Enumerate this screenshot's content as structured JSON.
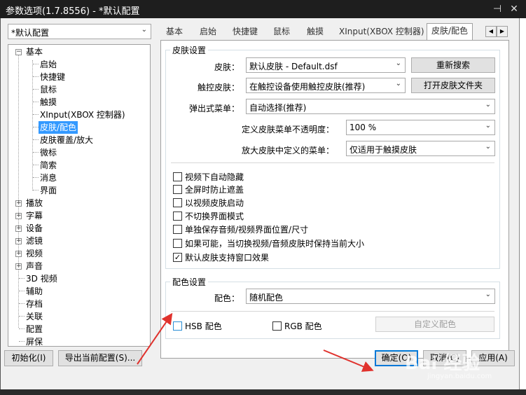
{
  "window": {
    "title": "参数选项(1.7.8556) - *默认配置",
    "pin_icon": "pin-icon",
    "close_icon": "close-icon"
  },
  "profile_combo": {
    "value": "*默认配置"
  },
  "tree": {
    "root": "基本",
    "children": [
      "启始",
      "快捷键",
      "鼠标",
      "触摸",
      "XInput(XBOX 控制器)",
      "皮肤/配色",
      "皮肤覆盖/放大",
      "微标",
      "简索",
      "消息",
      "界面"
    ],
    "selected": "皮肤/配色",
    "collapsed": [
      "播放",
      "字幕",
      "设备",
      "滤镜",
      "视频",
      "声音"
    ],
    "leaves": [
      "3D 视频",
      "辅助",
      "存档",
      "关联",
      "配置",
      "屏保"
    ]
  },
  "tabs": [
    "基本",
    "启始",
    "快捷键",
    "鼠标",
    "触摸",
    "XInput(XBOX 控制器)",
    "皮肤/配色"
  ],
  "active_tab": "皮肤/配色",
  "skin_settings": {
    "group_title": "皮肤设置",
    "skin_label": "皮肤：",
    "skin_value": "默认皮肤 - Default.dsf",
    "research_button": "重新搜索",
    "touch_skin_label": "触控皮肤：",
    "touch_skin_value": "在触控设备使用触控皮肤(推荐)",
    "open_folder_button": "打开皮肤文件夹",
    "popup_menu_label": "弹出式菜单：",
    "popup_menu_value": "自动选择(推荐)",
    "opacity_label": "定义皮肤菜单不透明度：",
    "opacity_value": "100 %",
    "zoom_menu_label": "放大皮肤中定义的菜单：",
    "zoom_menu_value": "仅适用于触摸皮肤",
    "checkboxes": [
      {
        "label": "视频下自动隐藏",
        "checked": false
      },
      {
        "label": "全屏时防止遮盖",
        "checked": false
      },
      {
        "label": "以视频皮肤启动",
        "checked": false
      },
      {
        "label": "不切换界面模式",
        "checked": false
      },
      {
        "label": "单独保存音频/视频界面位置/尺寸",
        "checked": false
      },
      {
        "label": "如果可能，当切换视频/音频皮肤时保持当前大小",
        "checked": false
      },
      {
        "label": "默认皮肤支持窗口效果",
        "checked": true
      }
    ],
    "check_mark": "✓"
  },
  "color_settings": {
    "group_title": "配色设置",
    "color_label": "配色：",
    "color_value": "随机配色",
    "hsb_label": "HSB 配色",
    "rgb_label": "RGB 配色",
    "custom_button": "自定义配色"
  },
  "bottom_buttons": {
    "init": "初始化(I)",
    "export": "导出当前配置(S)...",
    "ok": "确定(O)",
    "cancel": "取消(C)",
    "apply": "应用(A)"
  },
  "watermark": "Bai 经验",
  "watermark_sub": "jingyan.baidu.com",
  "colors": {
    "accent": "#3399ff",
    "arrow": "#e0322d",
    "titlebar": "#1e1e1e"
  }
}
